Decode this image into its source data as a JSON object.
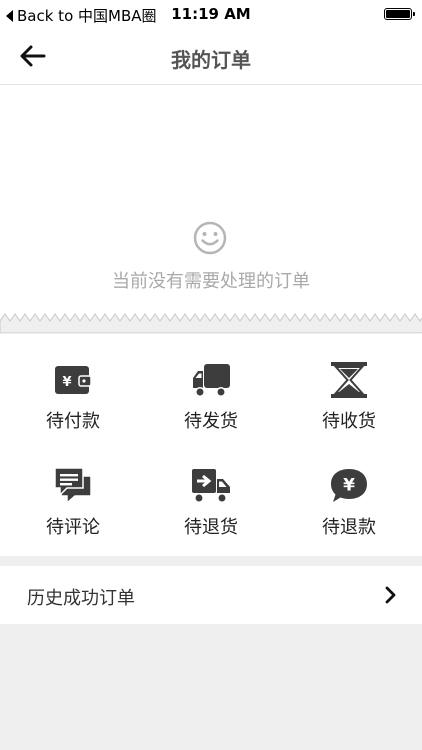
{
  "status_bar": {
    "back_label": "Back to 中国MBA圈",
    "time": "11:19 AM"
  },
  "nav": {
    "title": "我的订单"
  },
  "empty_state": {
    "message": "当前没有需要处理的订单",
    "icon": "smiley-icon"
  },
  "order_types": [
    {
      "label": "待付款",
      "icon": "wallet-yuan-icon"
    },
    {
      "label": "待发货",
      "icon": "truck-icon"
    },
    {
      "label": "待收货",
      "icon": "hourglass-icon"
    },
    {
      "label": "待评论",
      "icon": "chat-bubble-icon"
    },
    {
      "label": "待退货",
      "icon": "return-truck-icon"
    },
    {
      "label": "待退款",
      "icon": "yuan-bubble-icon"
    }
  ],
  "history": {
    "label": "历史成功订单"
  },
  "colors": {
    "icon_dark": "#3d3d3d",
    "muted_text": "#a9a9a9",
    "background": "#efefef"
  }
}
